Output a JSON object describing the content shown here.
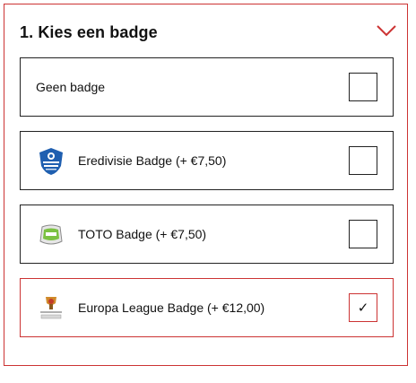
{
  "section": {
    "title": "1. Kies een badge",
    "toggle_icon": "chevron-down-icon"
  },
  "options": [
    {
      "label": "Geen badge",
      "icon": null,
      "checked": false
    },
    {
      "label": "Eredivisie Badge (+ €7,50)",
      "icon": "eredivisie-badge-icon",
      "checked": false
    },
    {
      "label": "TOTO Badge (+ €7,50)",
      "icon": "toto-badge-icon",
      "checked": false
    },
    {
      "label": "Europa League Badge (+ €12,00)",
      "icon": "europa-league-badge-icon",
      "checked": true,
      "check_glyph": "✓"
    }
  ],
  "colors": {
    "accent": "#cc3333",
    "border": "#222222",
    "text": "#111111"
  }
}
